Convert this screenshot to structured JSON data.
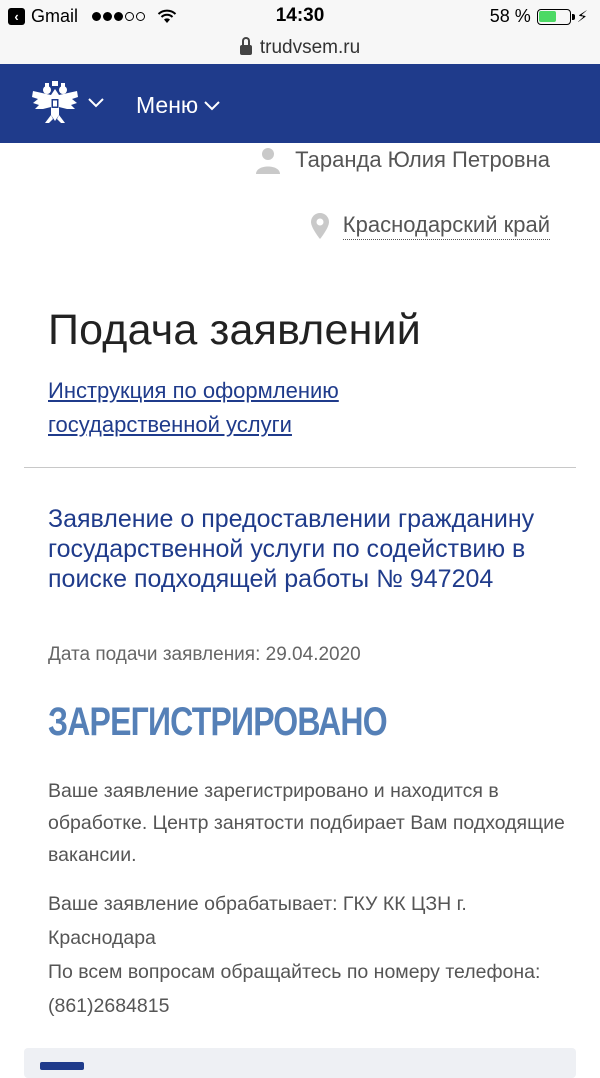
{
  "status_bar": {
    "back_app": "Gmail",
    "time": "14:30",
    "battery": "58 %",
    "battery_level": 0.58
  },
  "url_bar": {
    "domain": "trudvsem.ru"
  },
  "header": {
    "menu_label": "Меню"
  },
  "user": {
    "name": "Таранда Юлия Петровна",
    "region": "Краснодарский край"
  },
  "page": {
    "title": "Подача заявлений",
    "instruction_link": "Инструкция по оформлению государственной услуги"
  },
  "application": {
    "title": "Заявление о предоставлении гражданину государственной услуги по содействию в поиске подходящей работы № 947204",
    "date": "Дата подачи заявления: 29.04.2020",
    "status": "ЗАРЕГИСТРИРОВАНО",
    "description": "Ваше заявление зарегистрировано и находится в обработке. Центр занятости подбирает Вам подходящие вакансии.",
    "handler": "Ваше заявление обрабатывает: ГКУ КК ЦЗН г. Краснодара",
    "contact": "По всем вопросам обращайтесь по номеру телефона: (861)2684815"
  },
  "colors": {
    "header_bg": "#1f3b8b",
    "link": "#1f3b8b",
    "status": "#5580b7",
    "battery": "#4cd964"
  },
  "icons": {
    "emblem": "coat-of-arms-icon",
    "user": "user-icon",
    "location": "map-pin-icon",
    "lock": "lock-icon"
  }
}
